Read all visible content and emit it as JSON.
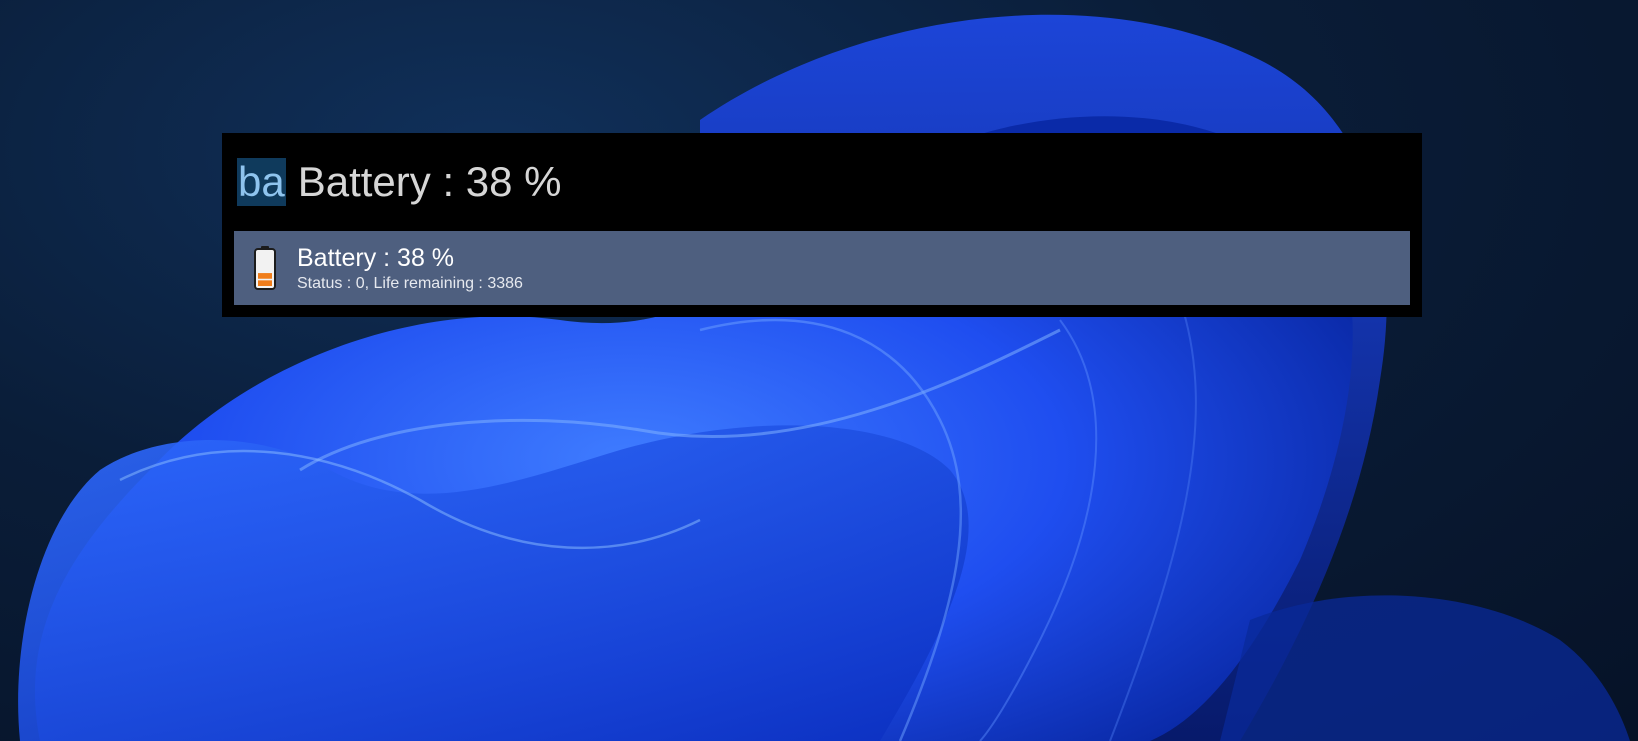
{
  "launcher": {
    "query": {
      "typed": "ba",
      "completion": "Battery : 38 %"
    },
    "results": [
      {
        "icon": "battery-icon",
        "title": "Battery : 38 %",
        "subtitle": "Status : 0, Life remaining : 3386",
        "battery_level": 38
      }
    ]
  },
  "colors": {
    "launcher_background": "#000000",
    "selected_result_background": "#4e5f7f",
    "typed_highlight": "#0f3a5c",
    "battery_fill": "#f07d1a"
  }
}
